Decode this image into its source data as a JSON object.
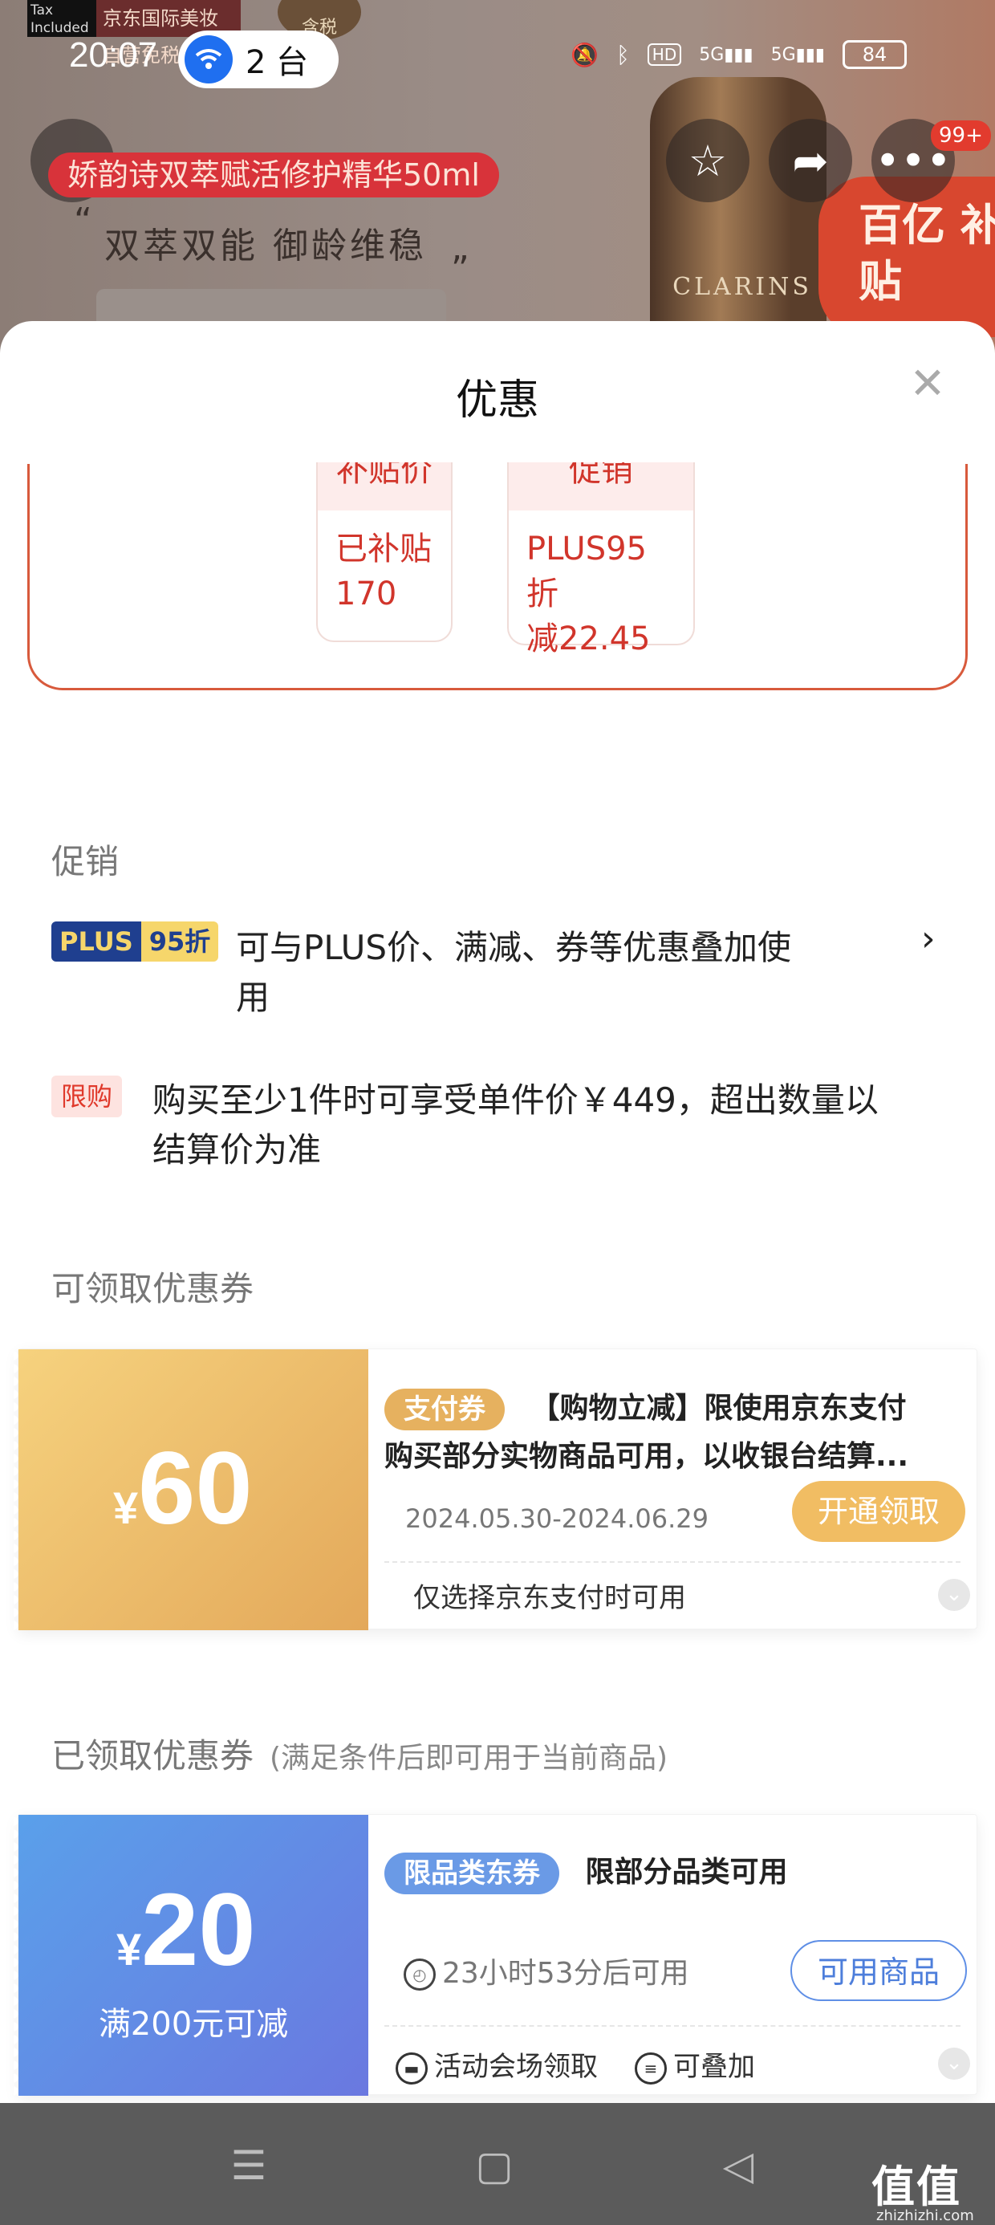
{
  "status_bar": {
    "time": "20:07",
    "connected_devices": "2 台",
    "battery": "84",
    "icons": [
      "mute-icon",
      "bluetooth-icon",
      "hd-icon",
      "5g-signal-icon",
      "5g-signal-icon",
      "battery-icon"
    ]
  },
  "banner": {
    "top_tag": "Tax Included",
    "shop_tag": "京东国际美妆 自营免税店",
    "tax_badge": "含税",
    "product_title": "娇韵诗双萃赋活修护精华50ml",
    "slogan": "双萃双能  御龄维稳",
    "bottle_brand": "CLARINS",
    "subsidy_stamp": "百亿 补贴",
    "cart_badge": "99+"
  },
  "sheet": {
    "title": "优惠",
    "price_cards": [
      {
        "header": "补贴价",
        "body": "已补贴\n170"
      },
      {
        "header": "促销",
        "body": "PLUS95折\n减22.45"
      }
    ],
    "promotion": {
      "label": "促销",
      "plus_badge_left": "PLUS",
      "plus_badge_right": "95折",
      "plus_text_line1": "可与PLUS价、满减、券等优惠叠加使",
      "plus_text_line2": "用",
      "limit_badge": "限购",
      "limit_text_line1": "购买至少1件时可享受单件价￥449，超出数量以",
      "limit_text_line2": "结算价为准"
    },
    "available_coupons": {
      "label": "可领取优惠券",
      "items": [
        {
          "currency": "¥",
          "amount": "60",
          "tag": "支付券",
          "title_line1": "【购物立减】限使用京东支付",
          "title_line2": "购买部分实物商品可用，以收银台结算...",
          "date": "2024.05.30-2024.06.29",
          "button": "开通领取",
          "footer": "仅选择京东支付时可用",
          "color": "#e9b15e"
        }
      ]
    },
    "claimed_coupons": {
      "label": "已领取优惠券",
      "sub": "(满足条件后即可用于当前商品)",
      "items": [
        {
          "currency": "¥",
          "amount": "20",
          "condition": "满200元可减",
          "tag": "限品类东券",
          "title": "限部分品类可用",
          "countdown": "23小时53分后可用",
          "button": "可用商品",
          "footer_a": "活动会场领取",
          "footer_b": "可叠加",
          "color": "#5f8fe6"
        }
      ]
    }
  },
  "watermark": {
    "text": "值值值",
    "sub": "zhizhizhi.com"
  },
  "colors": {
    "accent_red": "#d1352b",
    "coupon_gold": "#e9b15e",
    "coupon_blue": "#5f8fe6",
    "plus_navy": "#1f3f8f"
  }
}
